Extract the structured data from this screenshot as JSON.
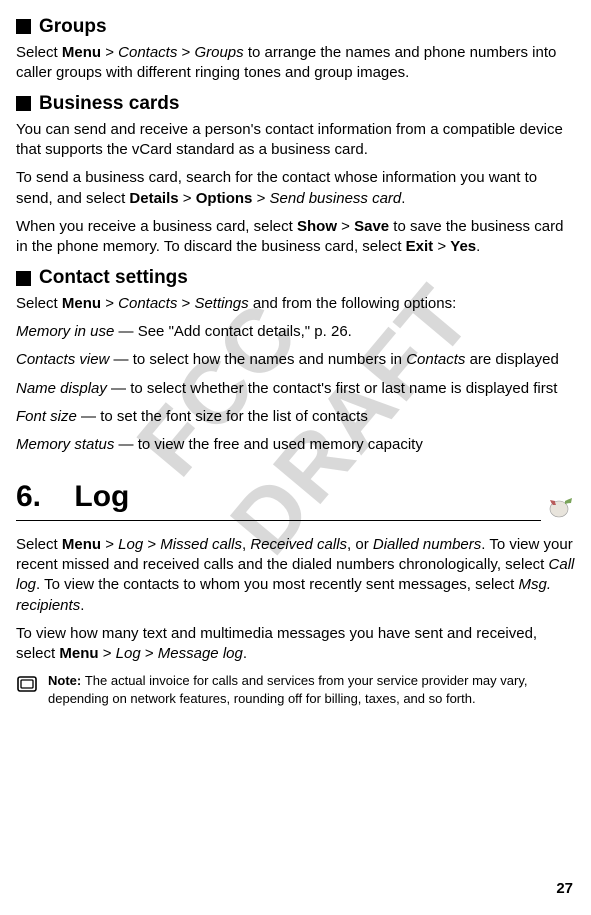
{
  "watermark": "FCC DRAFT",
  "sections": {
    "groups": {
      "title": "Groups",
      "p1_prefix": "Select ",
      "p1_menu": "Menu",
      "p1_sep1": " > ",
      "p1_contacts": "Contacts",
      "p1_sep2": " > ",
      "p1_groups": "Groups",
      "p1_suffix": " to arrange the names and phone numbers into caller groups with different ringing tones and group images."
    },
    "business": {
      "title": "Business cards",
      "p1": "You can send and receive a person's contact information from a compatible device that supports the vCard standard as a business card.",
      "p2_prefix": "To send a business card, search for the contact whose information you want to send, and select ",
      "p2_details": "Details",
      "p2_sep1": " > ",
      "p2_options": "Options",
      "p2_sep2": " > ",
      "p2_sendcard": "Send business card",
      "p2_period": ".",
      "p3_prefix": "When you receive a business card, select ",
      "p3_show": "Show",
      "p3_sep1": " > ",
      "p3_save": "Save",
      "p3_mid": " to save the business card in the phone memory. To discard the business card, select ",
      "p3_exit": "Exit",
      "p3_sep2": " > ",
      "p3_yes": "Yes",
      "p3_period": "."
    },
    "contact_settings": {
      "title": "Contact settings",
      "p1_prefix": "Select ",
      "p1_menu": "Menu",
      "p1_sep1": " > ",
      "p1_contacts": "Contacts",
      "p1_sep2": " > ",
      "p1_settings": "Settings",
      "p1_suffix": " and from the following options:",
      "opt1_label": "Memory in use",
      "opt1_text": " — See \"Add contact details,\" p. 26.",
      "opt2_label": "Contacts view",
      "opt2_text_a": " — to select how the names and numbers in ",
      "opt2_contacts": "Contacts",
      "opt2_text_b": " are displayed",
      "opt3_label": "Name display",
      "opt3_text": " — to select whether the contact's first or last name is displayed first",
      "opt4_label": "Font size",
      "opt4_text": " — to set the font size for the list of contacts",
      "opt5_label": "Memory status",
      "opt5_text": " — to view the free and used memory capacity"
    }
  },
  "chapter": {
    "number": "6.",
    "title": "Log"
  },
  "log": {
    "p1_prefix": "Select ",
    "p1_menu": "Menu",
    "p1_sep1": " > ",
    "p1_log": "Log",
    "p1_sep2": " > ",
    "p1_missed": "Missed calls",
    "p1_comma1": ", ",
    "p1_received": "Received calls",
    "p1_comma2": ", or ",
    "p1_dialled": "Dialled numbers",
    "p1_mid1": ". To view your recent missed and received calls and the dialed numbers chronologically, select ",
    "p1_calllog": "Call log",
    "p1_mid2": ". To view the contacts to whom you most recently sent messages, select ",
    "p1_msgrec": "Msg. recipients",
    "p1_period": ".",
    "p2_prefix": "To view how many text and multimedia messages you have sent and received, select ",
    "p2_menu": "Menu",
    "p2_sep1": " > ",
    "p2_log": "Log",
    "p2_sep2": " > ",
    "p2_msglog": "Message log",
    "p2_period": ".",
    "note_label": "Note: ",
    "note_text": "The actual invoice for calls and services from your service provider may vary, depending on network features, rounding off for billing, taxes, and so forth."
  },
  "page_number": "27"
}
